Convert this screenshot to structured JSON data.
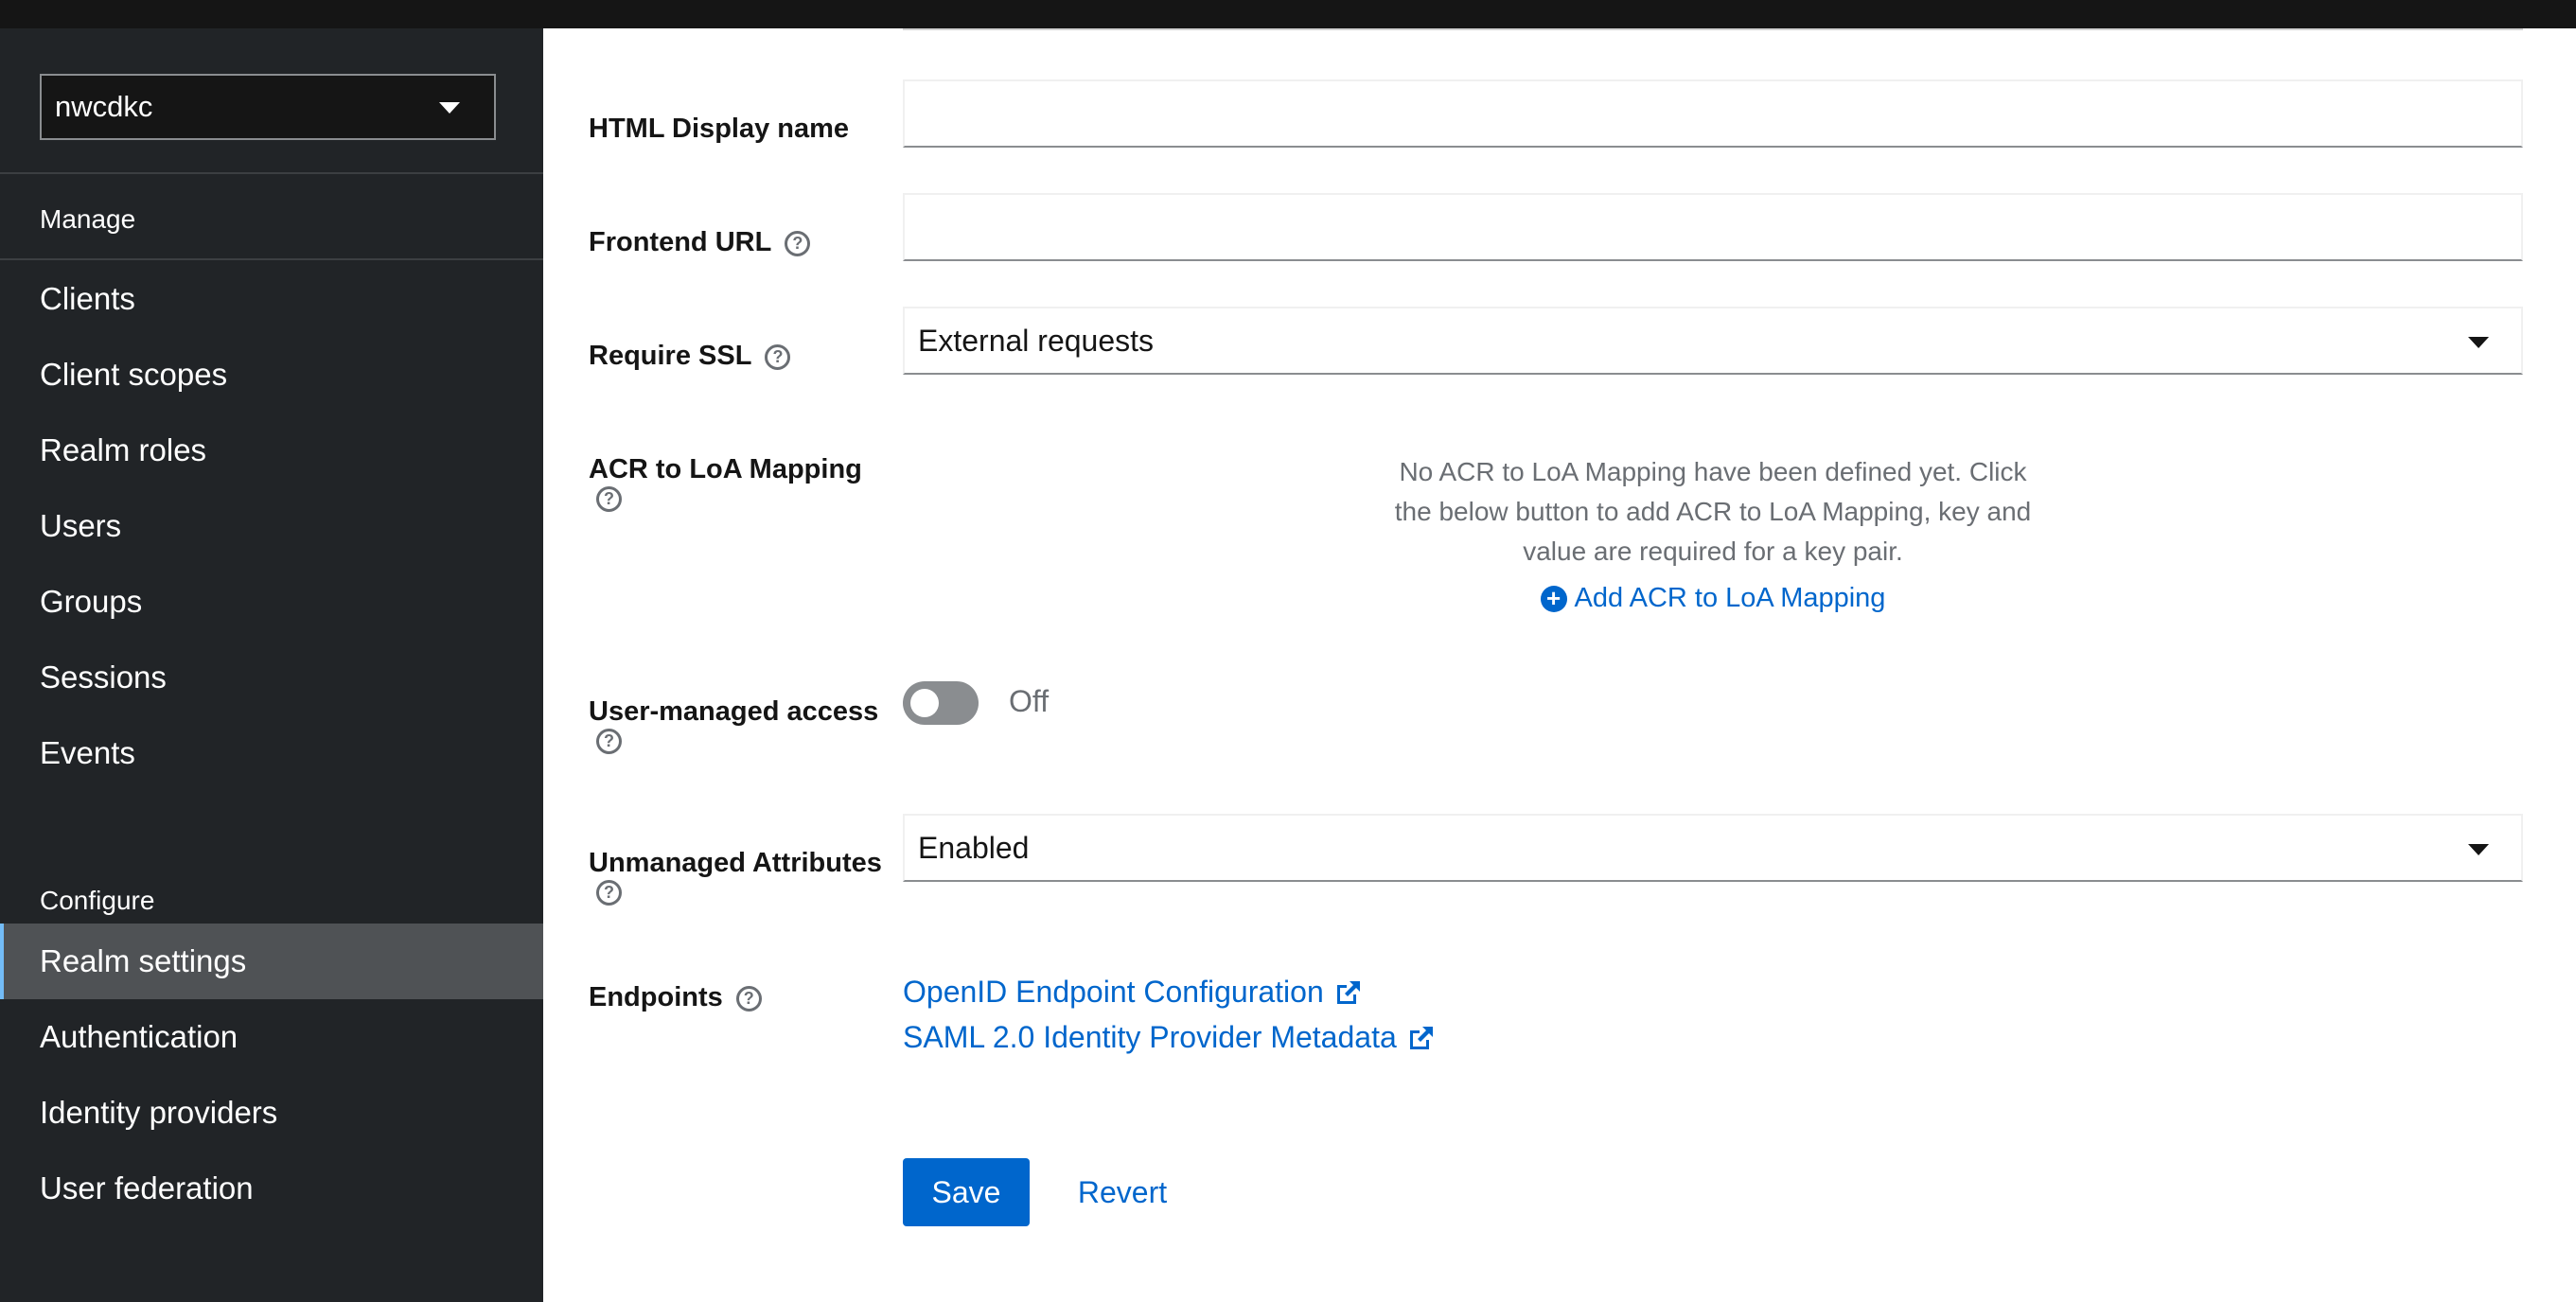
{
  "sidebar": {
    "realm": "nwcdkc",
    "sections": [
      {
        "title": "Manage",
        "items": [
          {
            "label": "Clients"
          },
          {
            "label": "Client scopes"
          },
          {
            "label": "Realm roles"
          },
          {
            "label": "Users"
          },
          {
            "label": "Groups"
          },
          {
            "label": "Sessions"
          },
          {
            "label": "Events"
          }
        ]
      },
      {
        "title": "Configure",
        "items": [
          {
            "label": "Realm settings",
            "active": true
          },
          {
            "label": "Authentication"
          },
          {
            "label": "Identity providers"
          },
          {
            "label": "User federation"
          }
        ]
      }
    ]
  },
  "form": {
    "html_display_name": {
      "label": "HTML Display name",
      "value": ""
    },
    "frontend_url": {
      "label": "Frontend URL",
      "value": ""
    },
    "require_ssl": {
      "label": "Require SSL",
      "value": "External requests"
    },
    "acr_loa": {
      "label": "ACR to LoA Mapping",
      "empty_text": "No ACR to LoA Mapping have been defined yet. Click the below button to add ACR to LoA Mapping, key and value are required for a key pair.",
      "add_label": "Add ACR to LoA Mapping"
    },
    "user_managed_access": {
      "label": "User-managed access",
      "state": "Off"
    },
    "unmanaged_attributes": {
      "label": "Unmanaged Attributes",
      "value": "Enabled"
    },
    "endpoints": {
      "label": "Endpoints",
      "links": [
        {
          "label": "OpenID Endpoint Configuration"
        },
        {
          "label": "SAML 2.0 Identity Provider Metadata"
        }
      ]
    }
  },
  "actions": {
    "save": "Save",
    "revert": "Revert"
  },
  "colors": {
    "sidebar_bg": "#212427",
    "active_item_bg": "#4f5255",
    "primary": "#0066cc",
    "topbar": "#151515"
  }
}
